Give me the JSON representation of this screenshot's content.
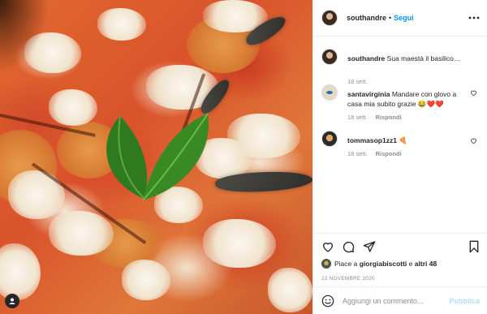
{
  "post": {
    "image_alt": "pizza",
    "author": "southandre",
    "separator": "•",
    "follow_label": "Segui"
  },
  "comments": [
    {
      "user": "southandre",
      "text": "Sua maestà il basilico…",
      "time": "18 sett.",
      "reply": ""
    },
    {
      "user": "santavirginia",
      "text": "Mandare con glovo a casa mia subito grazie 😂❤️❤️",
      "time": "18 sett.",
      "reply": "Rispondi"
    },
    {
      "user": "tommasop1zz1",
      "text": "🍕",
      "time": "18 sett.",
      "reply": "Rispondi"
    }
  ],
  "likes": {
    "prefix": "Piace a",
    "user": "giorgiabiscotti",
    "joiner": "e",
    "others": "altri 48"
  },
  "date": "22 NOVEMBRE 2020",
  "comment_box": {
    "placeholder": "Aggiungi un commento...",
    "post_label": "Pubblica"
  },
  "icons": [
    "more-icon",
    "heart-icon",
    "comment-icon",
    "share-icon",
    "bookmark-icon",
    "emoji-icon",
    "user-tag-icon"
  ],
  "colors": {
    "link": "#0095f6",
    "muted": "#8e8e8e",
    "post_disabled": "#b2dffc",
    "border": "#efefef"
  }
}
